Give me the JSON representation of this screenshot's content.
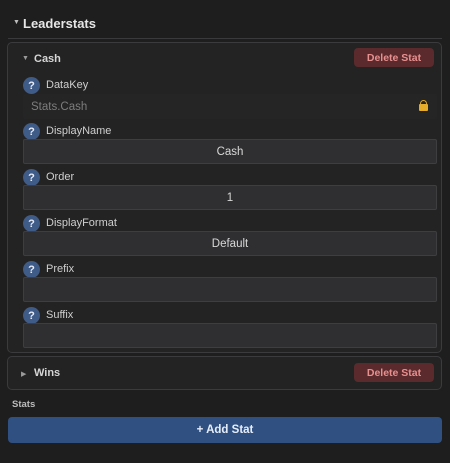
{
  "section": {
    "title": "Leaderstats",
    "expanded": true
  },
  "stats": [
    {
      "name": "Cash",
      "expanded": true,
      "delete_label": "Delete Stat",
      "fields": {
        "datakey": {
          "label": "DataKey",
          "value": "Stats.Cash",
          "locked": true
        },
        "displayname": {
          "label": "DisplayName",
          "value": "Cash"
        },
        "order": {
          "label": "Order",
          "value": "1"
        },
        "displayformat": {
          "label": "DisplayFormat",
          "value": "Default"
        },
        "prefix": {
          "label": "Prefix",
          "value": ""
        },
        "suffix": {
          "label": "Suffix",
          "value": ""
        }
      }
    },
    {
      "name": "Wins",
      "expanded": false,
      "delete_label": "Delete Stat"
    }
  ],
  "help_glyph": "?",
  "footer": {
    "caption": "Stats",
    "add_label": "+ Add Stat"
  },
  "colors": {
    "background": "#1e1e1f",
    "card": "#232324",
    "input": "#2f2f31",
    "help": "#3f5b87",
    "delete_bg": "#5a2a2c",
    "delete_text": "#e88f8f",
    "add_bg": "#2f5080",
    "lock": "#e8ac2b"
  },
  "icons": {
    "section_toggle": "triangle-down-icon",
    "cash_toggle": "triangle-down-icon",
    "wins_toggle": "triangle-right-icon",
    "help": "question-icon",
    "lock": "lock-icon"
  }
}
